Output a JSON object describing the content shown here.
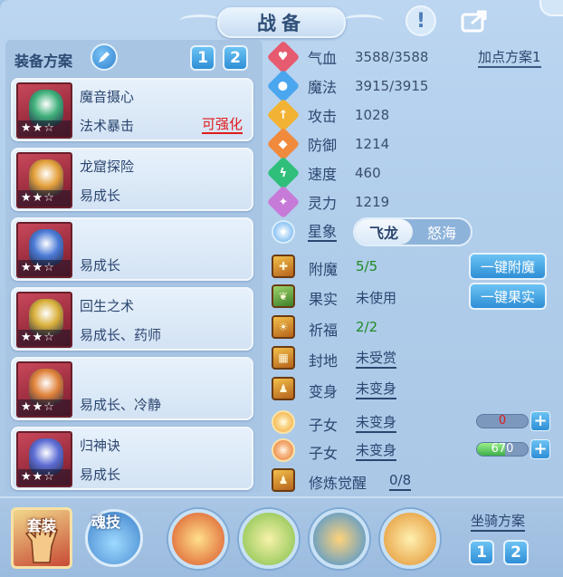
{
  "header": {
    "title": "战备"
  },
  "equip": {
    "label": "装备方案",
    "plan_buttons": [
      "1",
      "2"
    ]
  },
  "cards": [
    {
      "name": "魔音摄心",
      "trait": "法术暴击",
      "tag": "可强化",
      "stars": "★★☆",
      "colors": [
        "#c8485b",
        "#3fb07a"
      ]
    },
    {
      "name": "龙窟探险",
      "trait": "易成长",
      "tag": "",
      "stars": "★★☆",
      "colors": [
        "#c8485b",
        "#e4a03a"
      ]
    },
    {
      "name": "",
      "trait": "易成长",
      "tag": "",
      "stars": "★★☆",
      "colors": [
        "#c8485b",
        "#4b7bd6"
      ]
    },
    {
      "name": "回生之术",
      "trait": "易成长、药师",
      "tag": "",
      "stars": "★★☆",
      "colors": [
        "#c8485b",
        "#d9b03b"
      ]
    },
    {
      "name": "",
      "trait": "易成长、冷静",
      "tag": "",
      "stars": "★★☆",
      "colors": [
        "#c8485b",
        "#e0823a"
      ]
    },
    {
      "name": "归神诀",
      "trait": "易成长",
      "tag": "",
      "stars": "★★☆",
      "colors": [
        "#c8485b",
        "#5f6fd6"
      ]
    }
  ],
  "stats": [
    {
      "name": "气血",
      "value": "3588/3588",
      "color": "#e65b6f",
      "glyph": "♥"
    },
    {
      "name": "魔法",
      "value": "3915/3915",
      "color": "#4aa6ef",
      "glyph": "●"
    },
    {
      "name": "攻击",
      "value": "1028",
      "color": "#f2b233",
      "glyph": "↑"
    },
    {
      "name": "防御",
      "value": "1214",
      "color": "#f08a3c",
      "glyph": "◆"
    },
    {
      "name": "速度",
      "value": "460",
      "color": "#2fbf7b",
      "glyph": "ϟ"
    },
    {
      "name": "灵力",
      "value": "1219",
      "color": "#c77ad8",
      "glyph": "✦"
    }
  ],
  "add_point_plan": "加点方案1",
  "star": {
    "label": "星象",
    "options": [
      "飞龙",
      "怒海"
    ],
    "selected": "飞龙"
  },
  "rows": [
    {
      "label": "附魔",
      "value": "5/5",
      "style": "green",
      "button": "一键附魔"
    },
    {
      "label": "果实",
      "value": "未使用",
      "style": "plain",
      "button": "一键果实"
    },
    {
      "label": "祈福",
      "value": "2/2",
      "style": "green",
      "button": ""
    },
    {
      "label": "封地",
      "value": "未受赏",
      "style": "ul",
      "button": ""
    },
    {
      "label": "变身",
      "value": "未变身",
      "style": "ul",
      "button": ""
    },
    {
      "label": "子女",
      "value": "未变身",
      "style": "ul",
      "button": ""
    },
    {
      "label": "子女",
      "value": "未变身",
      "style": "ul",
      "button": ""
    },
    {
      "label": "修炼觉醒",
      "value": "0/8",
      "style": "ul",
      "button": ""
    }
  ],
  "child_bars": [
    {
      "value": "0",
      "fill": 0,
      "text_color": "#e01a1a"
    },
    {
      "value": "670",
      "fill": 0.55,
      "text_color": "#ffffff"
    }
  ],
  "bottom": {
    "set_label": "套装",
    "skill_label": "魂技",
    "mount_label": "坐骑方案",
    "mount_buttons": [
      "1",
      "2"
    ]
  }
}
